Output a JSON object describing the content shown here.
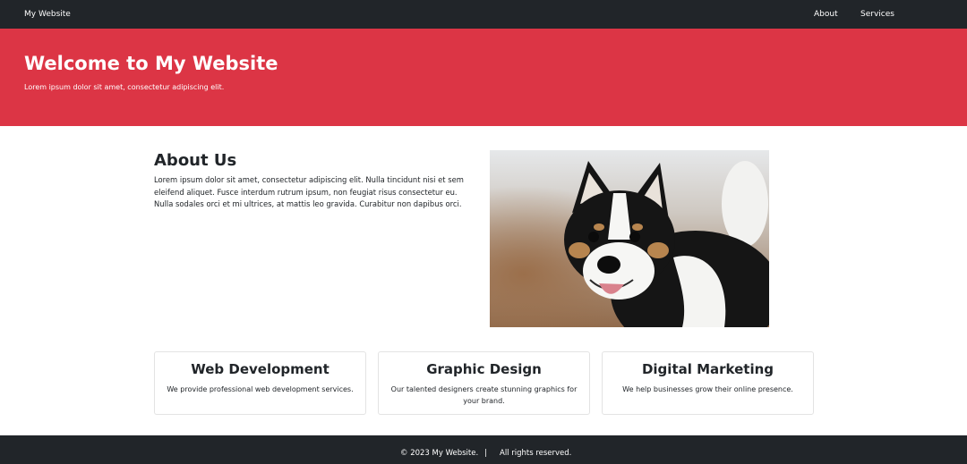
{
  "navbar": {
    "brand": "My Website",
    "links": [
      {
        "label": "About"
      },
      {
        "label": "Services"
      }
    ]
  },
  "hero": {
    "title": "Welcome to My Website",
    "subtitle": "Lorem ipsum dolor sit amet, consectetur adipiscing elit."
  },
  "about": {
    "title": "About Us",
    "text": "Lorem ipsum dolor sit amet, consectetur adipiscing elit. Nulla tincidunt nisi et sem eleifend aliquet. Fusce interdum rutrum ipsum, non feugiat risus consectetur eu. Nulla sodales orci et mi ultrices, at mattis leo gravida. Curabitur non dapibus orci.",
    "image": "dog-photo"
  },
  "services": [
    {
      "title": "Web Development",
      "text": "We provide professional web development services."
    },
    {
      "title": "Graphic Design",
      "text": "Our talented designers create stunning graphics for your brand."
    },
    {
      "title": "Digital Marketing",
      "text": "We help businesses grow their online presence."
    }
  ],
  "footer": {
    "copyright": "© 2023 My Website.",
    "separator": "|",
    "rights": "All rights reserved."
  },
  "colors": {
    "navbar": "#212529",
    "hero": "#dc3545",
    "text": "#212529"
  }
}
